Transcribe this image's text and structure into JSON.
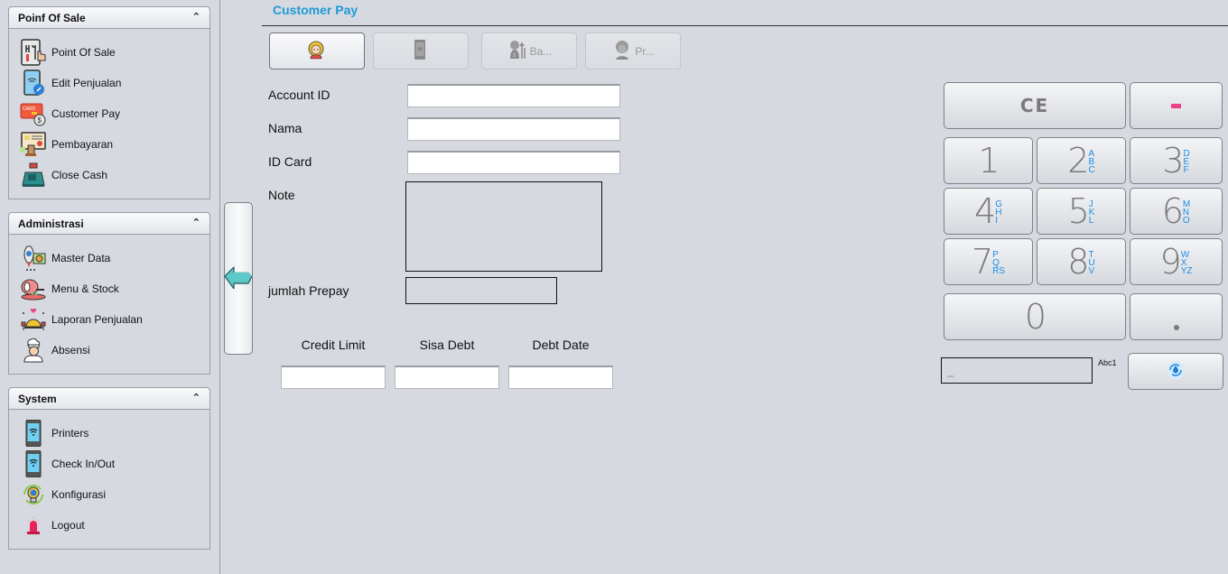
{
  "sidebar": {
    "groups": [
      {
        "title": "Poinf Of Sale",
        "collapse_icon": "double-chevron-up",
        "items": [
          {
            "label": "Point Of Sale",
            "icon": "pos-terminal-icon"
          },
          {
            "label": "Edit Penjualan",
            "icon": "edit-sale-phone-icon"
          },
          {
            "label": "Customer Pay",
            "icon": "card-payment-icon"
          },
          {
            "label": "Pembayaran",
            "icon": "payment-terminal-icon"
          },
          {
            "label": "Close Cash",
            "icon": "cash-register-icon"
          }
        ]
      },
      {
        "title": "Administrasi",
        "collapse_icon": "double-chevron-up",
        "items": [
          {
            "label": "Master Data",
            "icon": "rocket-gear-icon"
          },
          {
            "label": "Menu & Stock",
            "icon": "meat-dish-icon"
          },
          {
            "label": "Laporan Penjualan",
            "icon": "cloche-report-icon"
          },
          {
            "label": "Absensi",
            "icon": "chef-icon"
          }
        ]
      },
      {
        "title": "System",
        "collapse_icon": "double-chevron-up",
        "items": [
          {
            "label": "Printers",
            "icon": "wifi-phone-icon"
          },
          {
            "label": "Check In/Out",
            "icon": "wifi-phone-icon"
          },
          {
            "label": "Konfigurasi",
            "icon": "lightbulb-globe-icon"
          },
          {
            "label": "Logout",
            "icon": "siren-icon"
          }
        ]
      }
    ]
  },
  "main": {
    "title": "Customer Pay",
    "tabs": [
      {
        "label": "",
        "icon": "customer-avatar-icon",
        "active": true
      },
      {
        "label": "",
        "icon": "phone-device-icon",
        "active": false
      },
      {
        "label": "Ba...",
        "icon": "money-bag-icon",
        "active": false
      },
      {
        "label": "Pr...",
        "icon": "profile-icon",
        "active": false
      }
    ],
    "form": {
      "account_id": {
        "label": "Account ID",
        "value": ""
      },
      "nama": {
        "label": "Nama",
        "value": ""
      },
      "id_card": {
        "label": "ID Card",
        "value": ""
      },
      "note": {
        "label": "Note",
        "value": ""
      },
      "jumlah_prepay": {
        "label": "jumlah Prepay",
        "value": ""
      }
    },
    "summary": {
      "credit_limit": {
        "label": "Credit Limit",
        "value": ""
      },
      "sisa_debt": {
        "label": "Sisa Debt",
        "value": ""
      },
      "debt_date": {
        "label": "Debt Date",
        "value": ""
      }
    }
  },
  "keypad": {
    "ce_label": "CE",
    "minus_label": "-",
    "keys": [
      {
        "digit": "1",
        "letters": ""
      },
      {
        "digit": "2",
        "letters": "ABC"
      },
      {
        "digit": "3",
        "letters": "DEF"
      },
      {
        "digit": "4",
        "letters": "GHI"
      },
      {
        "digit": "5",
        "letters": "JKL"
      },
      {
        "digit": "6",
        "letters": "MNO"
      },
      {
        "digit": "7",
        "letters": "PQRS"
      },
      {
        "digit": "8",
        "letters": "TUV"
      },
      {
        "digit": "9",
        "letters": "WXYZ"
      }
    ],
    "zero_label": "0",
    "dot_label": ".",
    "display_value": "_",
    "mode_label": "Abc1",
    "enter_icon": "refresh-drop-icon"
  },
  "colors": {
    "title_accent": "#1f9ad6",
    "keypad_letters": "#1b8ee8",
    "minus_key": "#ef3f86",
    "collapse_arrow": "#4cc2c4"
  }
}
